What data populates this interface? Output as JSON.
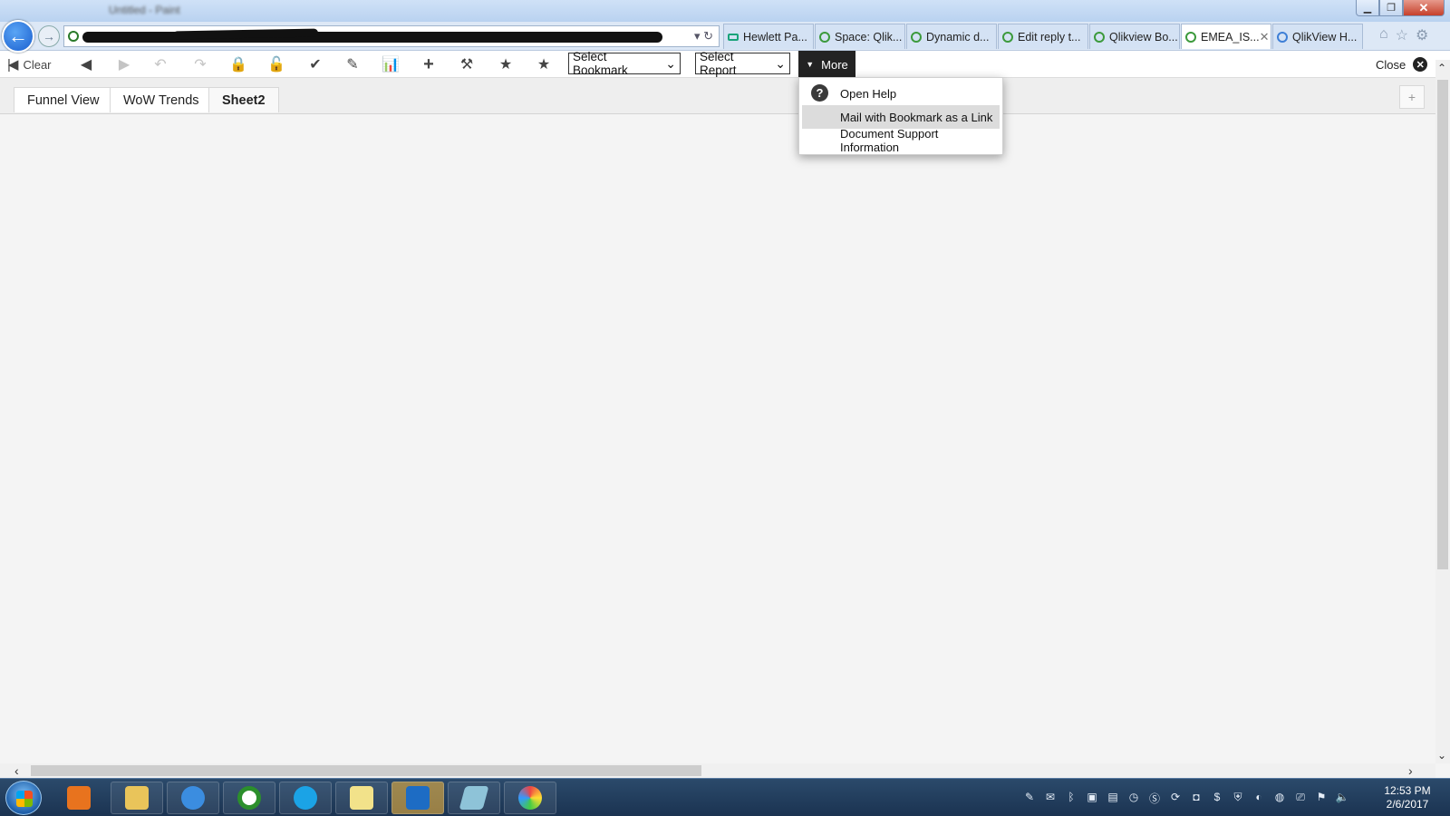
{
  "window": {
    "title": "Untitled - Paint"
  },
  "browser": {
    "tabs": [
      {
        "label": "Hewlett Pa...",
        "icon": "hpe-icon",
        "active": false
      },
      {
        "label": "Space: Qlik...",
        "icon": "qlik-icon",
        "active": false
      },
      {
        "label": "Dynamic d...",
        "icon": "qlik-icon",
        "active": false
      },
      {
        "label": "Edit reply t...",
        "icon": "qlik-icon",
        "active": false
      },
      {
        "label": "Qlikview Bo...",
        "icon": "qlik-icon",
        "active": false
      },
      {
        "label": "EMEA_IS...",
        "icon": "qlik-icon",
        "active": true
      },
      {
        "label": "QlikView H...",
        "icon": "ie-icon",
        "active": false
      }
    ]
  },
  "toolbar": {
    "clear_label": "Clear",
    "select_bookmark": "Select Bookmark",
    "select_report": "Select Report",
    "more_label": "More",
    "close_label": "Close"
  },
  "sheets": {
    "tabs": [
      {
        "label": "Funnel View"
      },
      {
        "label": "WoW Trends"
      },
      {
        "label": "Sheet2",
        "active": true
      }
    ],
    "add_label": "+"
  },
  "more_menu": {
    "items": [
      {
        "label": "Open Help",
        "icon": "help-icon"
      },
      {
        "label": "Mail with Bookmark as a Link",
        "highlighted": true
      },
      {
        "label": "Document Support Information"
      }
    ]
  },
  "taskbar": {
    "time": "12:53 PM",
    "date": "2/6/2017"
  },
  "colors": {
    "more_button": "#232323",
    "menu_highlight": "#dcdcdc",
    "taskbar": "#1b3351"
  }
}
